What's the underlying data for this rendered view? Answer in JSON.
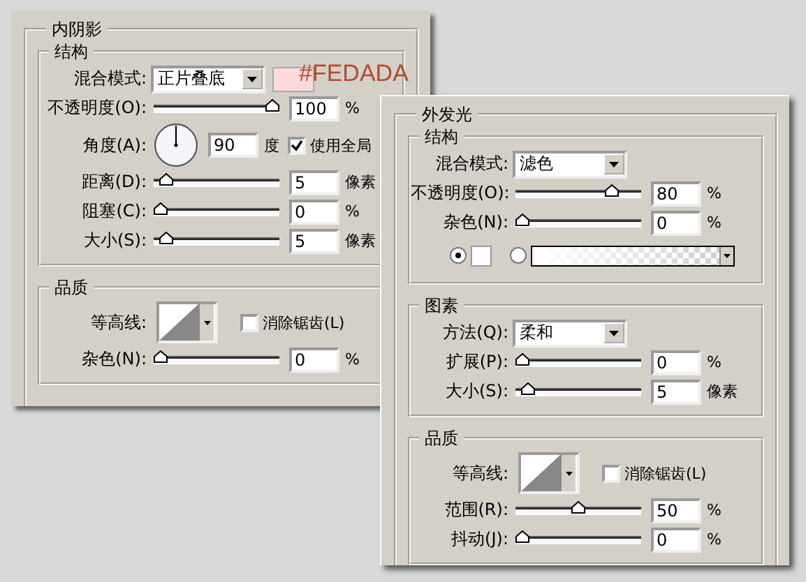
{
  "annotation": "#FEDADA",
  "panels": [
    {
      "title": "内阴影",
      "sections": [
        {
          "title": "结构",
          "rows": [
            {
              "kind": "select",
              "label": "混合模式:",
              "value": "正片叠底",
              "color": "#fedada"
            },
            {
              "kind": "slider",
              "label": "不透明度(O):",
              "level": 1,
              "value": "100",
              "unit": "%"
            },
            {
              "kind": "angle",
              "label": "角度(A):",
              "value": "90",
              "unit": "度",
              "check_label": "使用全局",
              "checked": true
            },
            {
              "kind": "slider",
              "label": "距离(D):",
              "level": 0.05,
              "value": "5",
              "unit": "像素"
            },
            {
              "kind": "slider",
              "label": "阻塞(C):",
              "level": 0,
              "value": "0",
              "unit": "%"
            },
            {
              "kind": "slider",
              "label": "大小(S):",
              "level": 0.05,
              "value": "5",
              "unit": "像素"
            }
          ]
        },
        {
          "title": "品质",
          "rows": [
            {
              "kind": "contour",
              "label": "等高线:",
              "check_label": "消除锯齿(L)",
              "checked": false
            },
            {
              "kind": "slider",
              "label": "杂色(N):",
              "level": 0,
              "value": "0",
              "unit": "%"
            }
          ]
        }
      ]
    },
    {
      "title": "外发光",
      "sections": [
        {
          "title": "结构",
          "rows": [
            {
              "kind": "select",
              "label": "混合模式:",
              "value": "滤色"
            },
            {
              "kind": "slider",
              "label": "不透明度(O):",
              "level": 0.8,
              "value": "80",
              "unit": "%"
            },
            {
              "kind": "slider",
              "label": "杂色(N):",
              "level": 0,
              "value": "0",
              "unit": "%"
            },
            {
              "kind": "fill",
              "options": [
                {
                  "kind": "color",
                  "color": "#ffffff",
                  "selected": true
                },
                {
                  "kind": "gradient",
                  "selected": false
                }
              ]
            }
          ]
        },
        {
          "title": "图素",
          "rows": [
            {
              "kind": "select",
              "label": "方法(Q):",
              "value": "柔和"
            },
            {
              "kind": "slider",
              "label": "扩展(P):",
              "level": 0,
              "value": "0",
              "unit": "%"
            },
            {
              "kind": "slider",
              "label": "大小(S):",
              "level": 0.05,
              "value": "5",
              "unit": "像素"
            }
          ]
        },
        {
          "title": "品质",
          "rows": [
            {
              "kind": "contour",
              "label": "等高线:",
              "check_label": "消除锯齿(L)",
              "checked": false
            },
            {
              "kind": "slider",
              "label": "范围(R):",
              "level": 0.5,
              "value": "50",
              "unit": "%"
            },
            {
              "kind": "slider",
              "label": "抖动(J):",
              "level": 0,
              "value": "0",
              "unit": "%"
            }
          ]
        }
      ]
    }
  ]
}
